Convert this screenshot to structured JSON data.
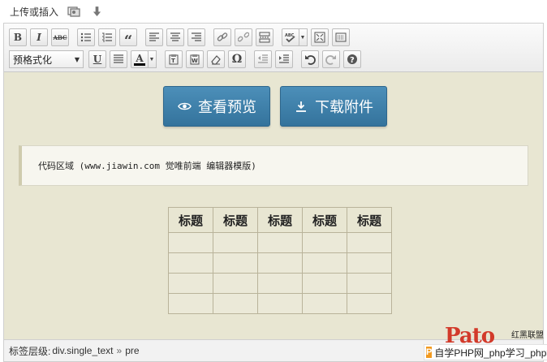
{
  "upload": {
    "label": "上传或插入"
  },
  "toolbar": {
    "bold": "B",
    "italic": "I",
    "strike": "ABC",
    "quote": "“",
    "format_select": "预格式化",
    "underline": "U",
    "text_color": "A",
    "special_char": "Ω"
  },
  "buttons": {
    "preview": "查看预览",
    "download": "下载附件"
  },
  "code_block": {
    "text": "代码区域 (www.jiawin.com 觉唯前端 编辑器模版)"
  },
  "table": {
    "headers": [
      "标题",
      "标题",
      "标题",
      "标题",
      "标题"
    ],
    "rows": [
      [
        "",
        "",
        "",
        "",
        ""
      ],
      [
        "",
        "",
        "",
        "",
        ""
      ],
      [
        "",
        "",
        "",
        "",
        ""
      ],
      [
        "",
        "",
        "",
        "",
        ""
      ]
    ]
  },
  "statusbar": {
    "label": "标签层级:",
    "path1": "div.single_text",
    "separator": "»",
    "path2": "pre"
  },
  "watermark": {
    "logo": "Pato",
    "site": "红黑联盟",
    "link_text": "自学PHP网_php学习_php教"
  },
  "icons": [
    "media-icon",
    "download-arrow-icon",
    "bullet-list-icon",
    "numbered-list-icon",
    "align-left-icon",
    "align-center-icon",
    "align-right-icon",
    "link-icon",
    "unlink-icon",
    "more-tag-icon",
    "spellcheck-icon",
    "fullscreen-icon",
    "kitchen-sink-icon",
    "justify-icon",
    "paste-text-icon",
    "paste-word-icon",
    "eraser-icon",
    "outdent-icon",
    "indent-icon",
    "undo-icon",
    "redo-icon",
    "help-icon",
    "eye-icon"
  ],
  "colors": {
    "content_bg": "#e8e6d2",
    "button_blue": "#3a7aa4",
    "watermark_red": "#d23a2a"
  }
}
